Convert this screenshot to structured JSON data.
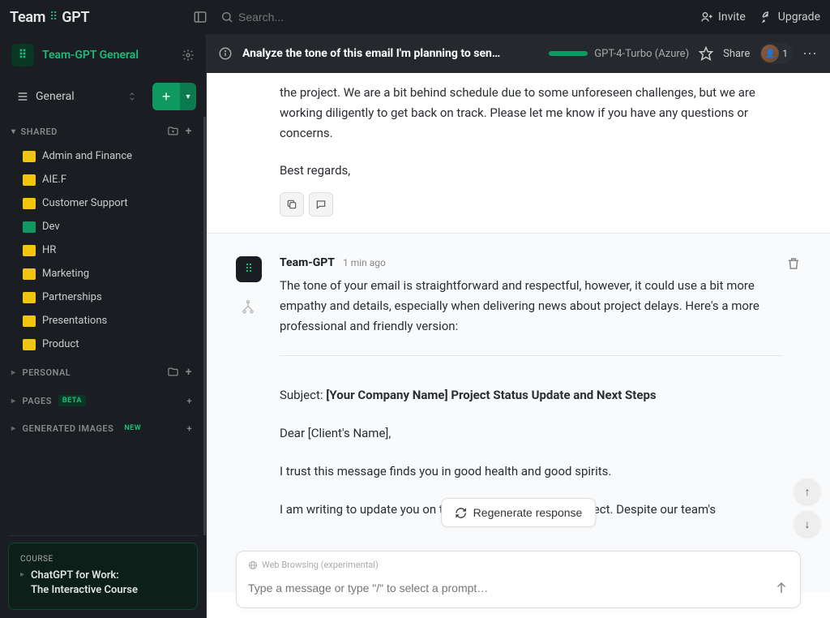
{
  "header": {
    "logo_primary": "Team",
    "logo_secondary": "GPT",
    "search_placeholder": "Search...",
    "invite": "Invite",
    "upgrade": "Upgrade"
  },
  "workspace": {
    "name": "Team-GPT General"
  },
  "general_selector": "General",
  "sections": {
    "shared": "SHARED",
    "personal": "PERSONAL",
    "pages": "PAGES",
    "pages_badge": "BETA",
    "images": "GENERATED IMAGES",
    "images_badge": "NEW"
  },
  "folders": [
    {
      "label": "Admin and Finance",
      "color": "yellow"
    },
    {
      "label": "AIE.F",
      "color": "yellow"
    },
    {
      "label": "Customer Support",
      "color": "yellow"
    },
    {
      "label": "Dev",
      "color": "green"
    },
    {
      "label": "HR",
      "color": "yellow"
    },
    {
      "label": "Marketing",
      "color": "yellow"
    },
    {
      "label": "Partnerships",
      "color": "yellow"
    },
    {
      "label": "Presentations",
      "color": "yellow"
    },
    {
      "label": "Product",
      "color": "yellow"
    }
  ],
  "course": {
    "label": "COURSE",
    "title1": "ChatGPT for Work:",
    "title2": "The Interactive Course"
  },
  "conversation": {
    "title": "Analyze the tone of this email I'm planning to sen...",
    "model": "GPT-4-Turbo (Azure)",
    "share": "Share",
    "avatar_count": "1"
  },
  "messages": {
    "user_fragment": "the project. We are a bit behind schedule due to some unforeseen challenges, but we are working diligently to get back on track. Please let me know if you have any questions or concerns.",
    "user_signoff": "Best regards,",
    "assistant_name": "Team-GPT",
    "assistant_time": "1 min ago",
    "assistant_intro": "The tone of your email is straightforward and respectful, however, it could use a bit more empathy and details, especially when delivering news about project delays. Here's a more professional and friendly version:",
    "subject_prefix": "Subject: ",
    "subject_body": "[Your Company Name] Project Status Update and Next Steps",
    "greeting": "Dear [Client's Name],",
    "line1": "I trust this message finds you in good health and good spirits.",
    "line2": "I am writing to update you on the current status of our project. Despite our team's"
  },
  "input": {
    "browsing": "Web Browsing (experimental)",
    "placeholder": "Type a message or type \"/\" to select a prompt…",
    "regenerate": "Regenerate response"
  }
}
